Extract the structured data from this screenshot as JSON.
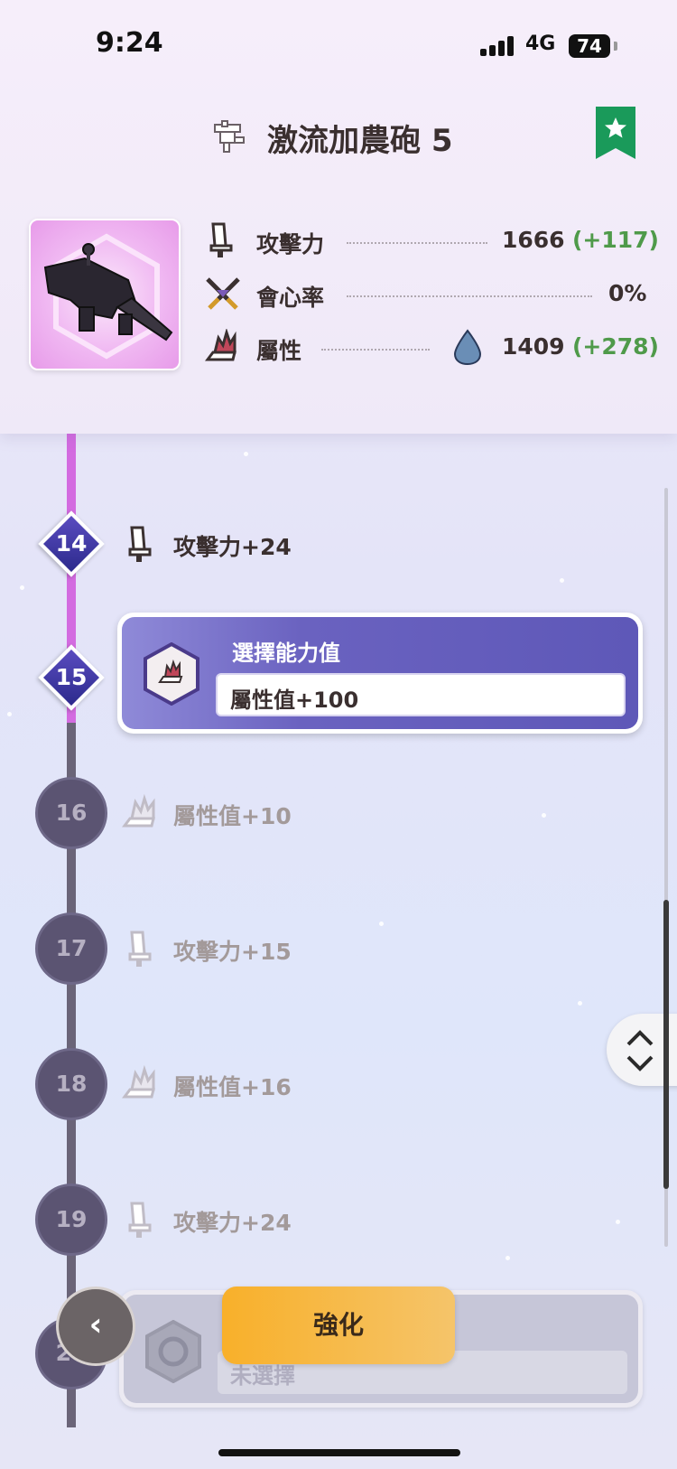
{
  "status_bar": {
    "time": "9:24",
    "network": "4G",
    "battery": "74"
  },
  "header": {
    "title": "激流加農砲 5",
    "weapon_type_icon": "heavy-bowgun-icon",
    "bookmark_icon": "star-bookmark-icon",
    "bookmark_color": "#1a9a5a"
  },
  "stats": [
    {
      "icon": "attack-blade-icon",
      "label": "攻擊力",
      "value": "1666",
      "bonus": "(+117)"
    },
    {
      "icon": "crossed-swords-icon",
      "label": "會心率",
      "value": "0%",
      "bonus": ""
    },
    {
      "icon": "element-flame-icon",
      "label": "屬性",
      "element_icon": "water-drop-icon",
      "value": "1409",
      "bonus": "(+278)"
    }
  ],
  "levels": [
    {
      "number": "14",
      "state": "done",
      "icon": "attack-blade-icon",
      "label": "攻擊力+24"
    },
    {
      "number": "15",
      "state": "current",
      "icon": "element-flame-icon",
      "choice_title": "選擇能力值",
      "choice_value": "屬性值+100"
    },
    {
      "number": "16",
      "state": "locked",
      "icon": "element-flame-icon",
      "label": "屬性值+10"
    },
    {
      "number": "17",
      "state": "locked",
      "icon": "attack-blade-icon",
      "label": "攻擊力+15"
    },
    {
      "number": "18",
      "state": "locked",
      "icon": "element-flame-icon",
      "label": "屬性值+16"
    },
    {
      "number": "19",
      "state": "locked",
      "icon": "attack-blade-icon",
      "label": "攻擊力+24"
    },
    {
      "number": "20",
      "state": "locked",
      "icon": "hex-empty-icon",
      "choice_value": "未選擇"
    }
  ],
  "buttons": {
    "enhance": "強化",
    "back_icon": "chevron-left-icon",
    "scroll_icon": "chevron-up-down-icon"
  },
  "colors": {
    "accent": "#5e58b8",
    "bonus_green": "#4f9a4a",
    "line_active": "#d36be0",
    "line_locked": "#6a6478"
  }
}
